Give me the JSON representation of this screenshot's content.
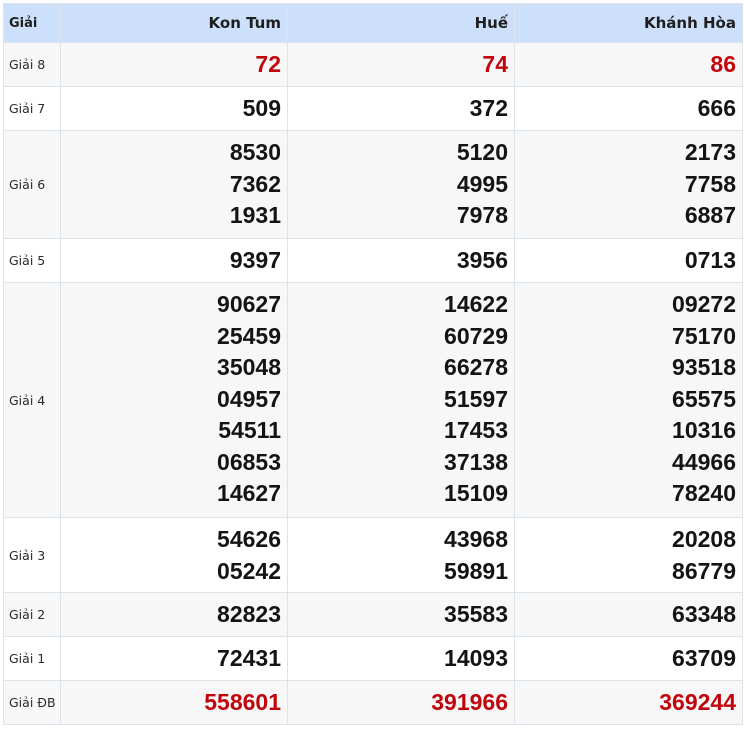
{
  "headers": {
    "prize": "Giải",
    "province_1": "Kon Tum",
    "province_2": "Huế",
    "province_3": "Khánh Hòa"
  },
  "rows": [
    {
      "label": "Giải 8",
      "kon_tum": [
        "72"
      ],
      "hue": [
        "74"
      ],
      "khanh_hoa": [
        "86"
      ]
    },
    {
      "label": "Giải 7",
      "kon_tum": [
        "509"
      ],
      "hue": [
        "372"
      ],
      "khanh_hoa": [
        "666"
      ]
    },
    {
      "label": "Giải 6",
      "kon_tum": [
        "8530",
        "7362",
        "1931"
      ],
      "hue": [
        "5120",
        "4995",
        "7978"
      ],
      "khanh_hoa": [
        "2173",
        "7758",
        "6887"
      ]
    },
    {
      "label": "Giải 5",
      "kon_tum": [
        "9397"
      ],
      "hue": [
        "3956"
      ],
      "khanh_hoa": [
        "0713"
      ]
    },
    {
      "label": "Giải 4",
      "kon_tum": [
        "90627",
        "25459",
        "35048",
        "04957",
        "54511",
        "06853",
        "14627"
      ],
      "hue": [
        "14622",
        "60729",
        "66278",
        "51597",
        "17453",
        "37138",
        "15109"
      ],
      "khanh_hoa": [
        "09272",
        "75170",
        "93518",
        "65575",
        "10316",
        "44966",
        "78240"
      ]
    },
    {
      "label": "Giải 3",
      "kon_tum": [
        "54626",
        "05242"
      ],
      "hue": [
        "43968",
        "59891"
      ],
      "khanh_hoa": [
        "20208",
        "86779"
      ]
    },
    {
      "label": "Giải 2",
      "kon_tum": [
        "82823"
      ],
      "hue": [
        "35583"
      ],
      "khanh_hoa": [
        "63348"
      ]
    },
    {
      "label": "Giải 1",
      "kon_tum": [
        "72431"
      ],
      "hue": [
        "14093"
      ],
      "khanh_hoa": [
        "63709"
      ]
    },
    {
      "label": "Giải ĐB",
      "kon_tum": [
        "558601"
      ],
      "hue": [
        "391966"
      ],
      "khanh_hoa": [
        "369244"
      ]
    }
  ],
  "colors": {
    "header_bg": "#cde0fb",
    "highlight_red": "#c0060c",
    "alt_row_bg": "#f7f7f7",
    "border": "#dde3ea"
  }
}
